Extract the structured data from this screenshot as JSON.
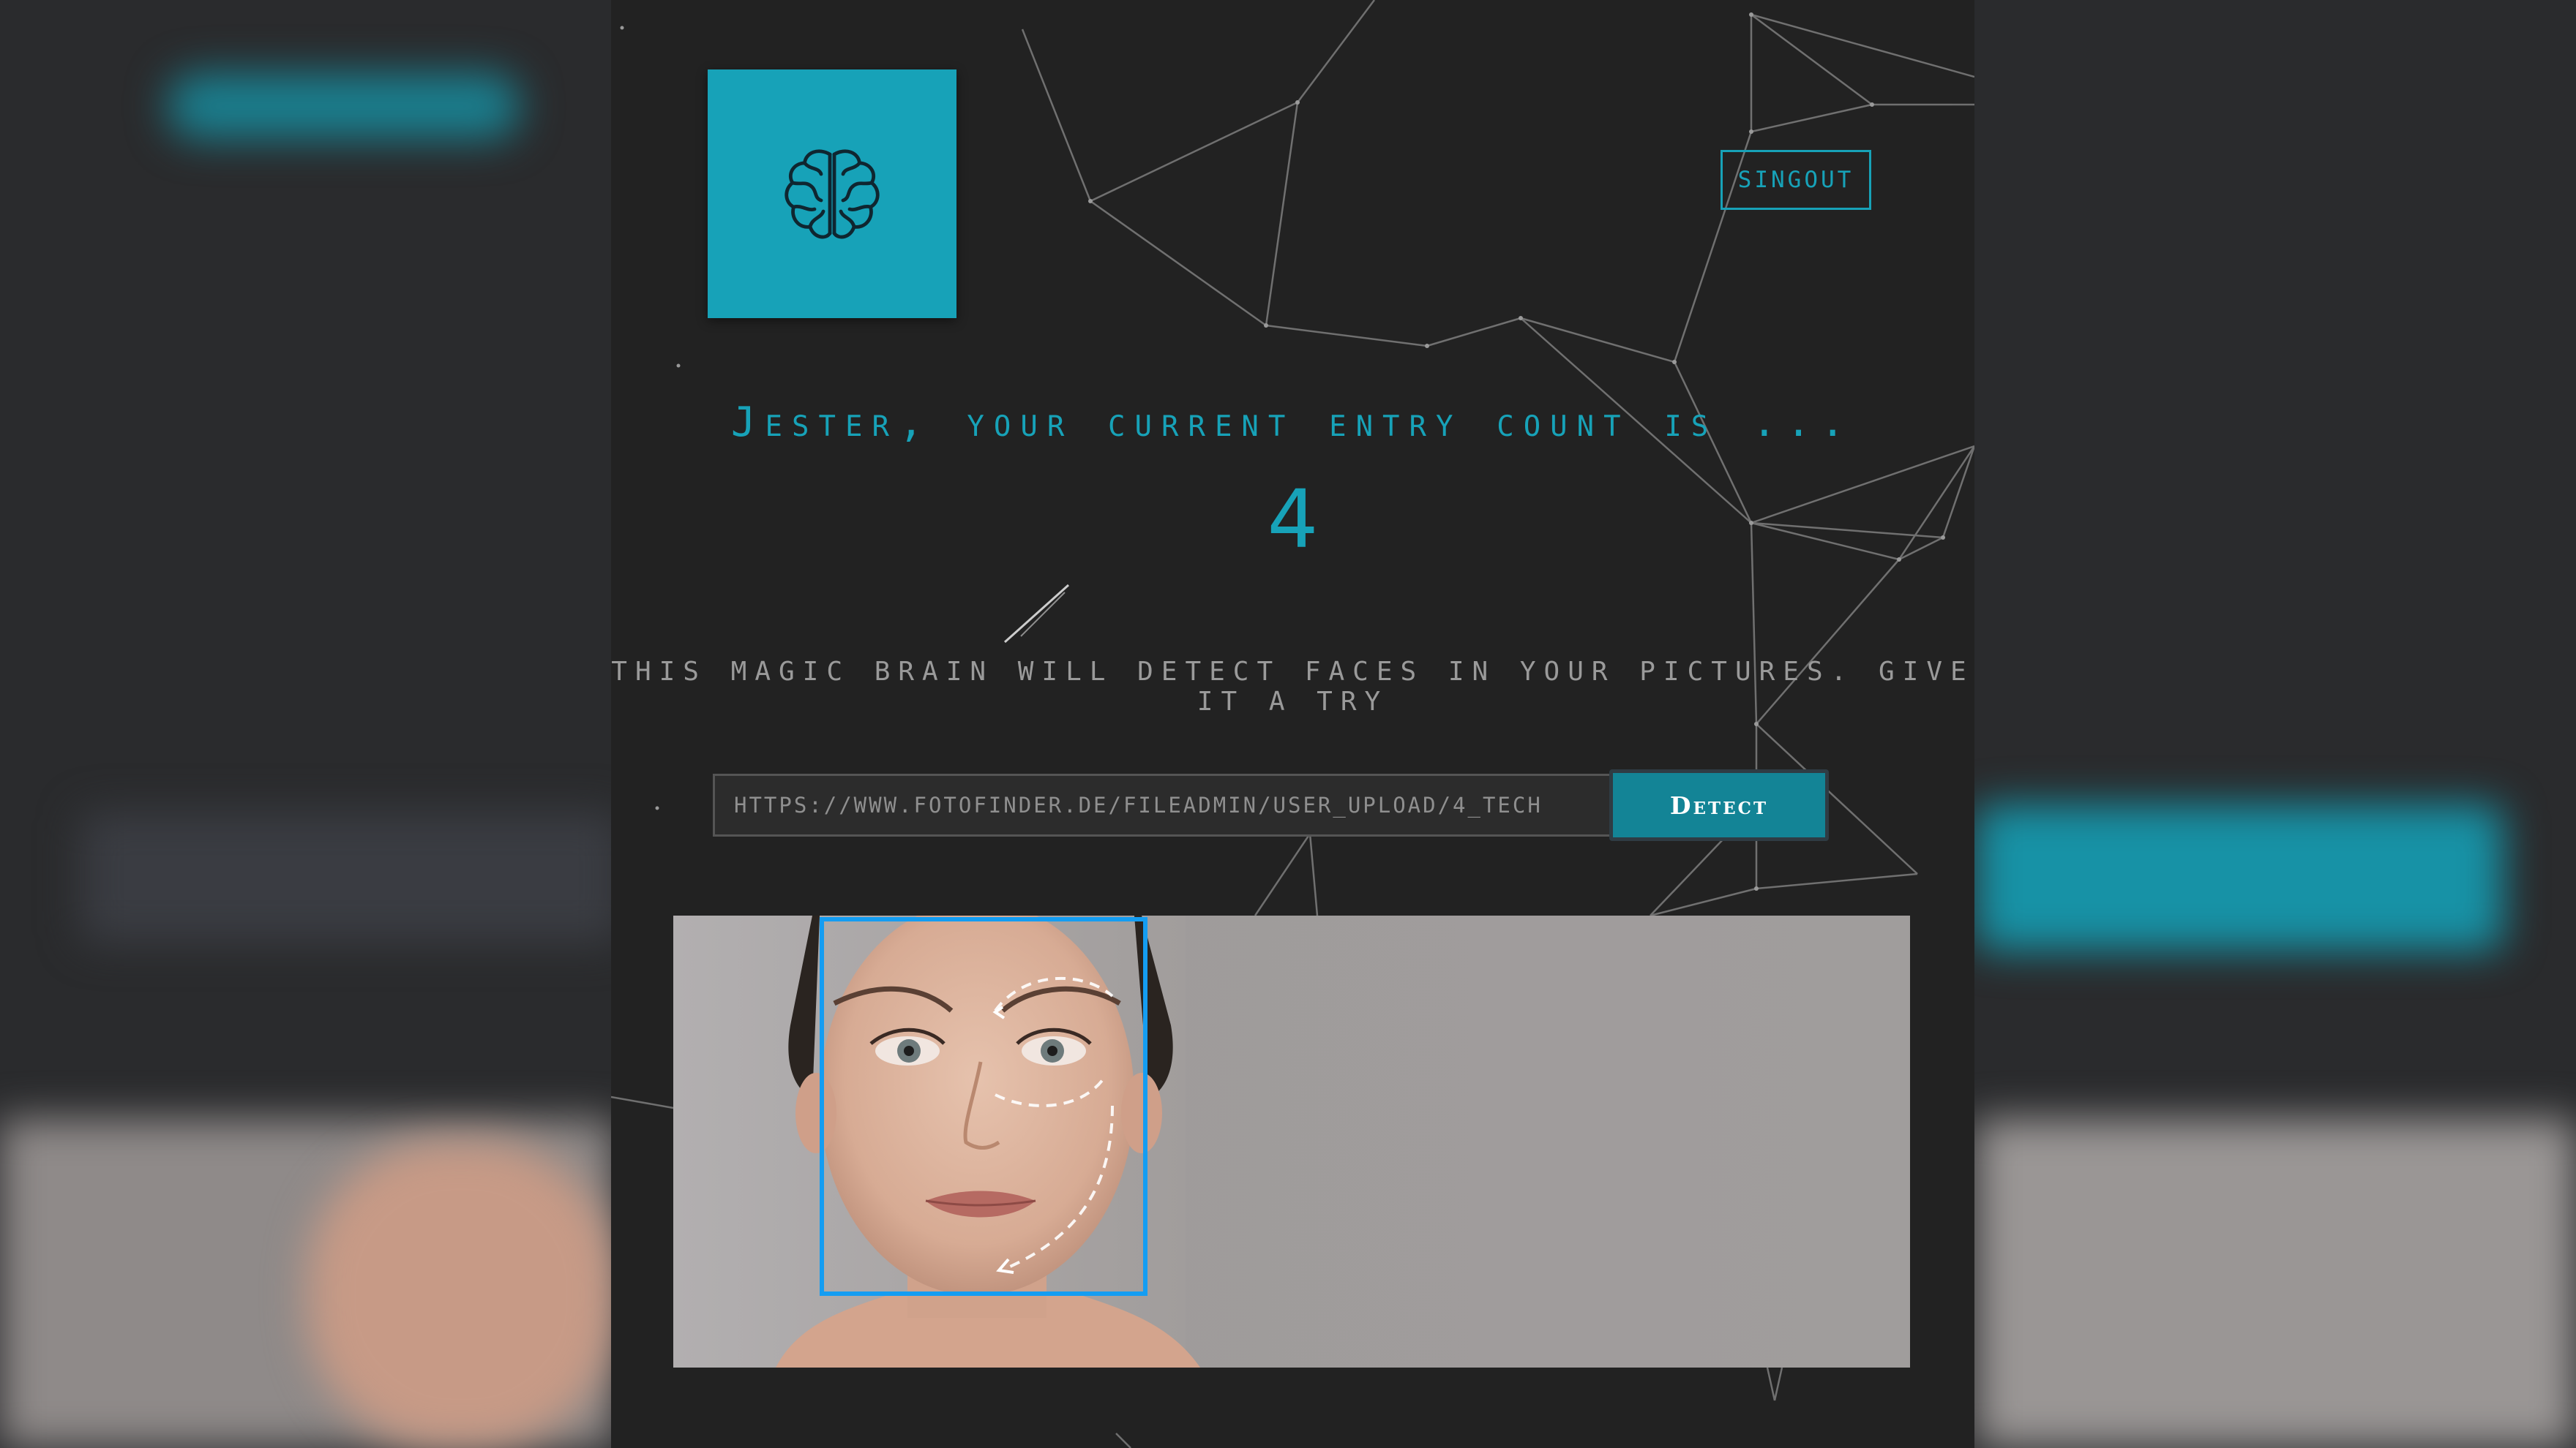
{
  "header": {
    "logo_icon": "brain-icon",
    "signout_label": "SINGOUT"
  },
  "main": {
    "greeting": "Jester, your current entry count is ...",
    "entry_count": "4",
    "tagline": "This Magic Brain will detect faces in your pictures. Give it a try"
  },
  "form": {
    "url_value": "https://www.fotofinder.de/fileadmin/user_upload/4_Tech",
    "detect_label": "Detect"
  },
  "colors": {
    "accent": "#17a2b8",
    "detect_button": "#138496",
    "face_box": "#149df2",
    "page_background": "#222222"
  },
  "result": {
    "image_subject": "woman-face-photo",
    "faces_detected": 1
  }
}
